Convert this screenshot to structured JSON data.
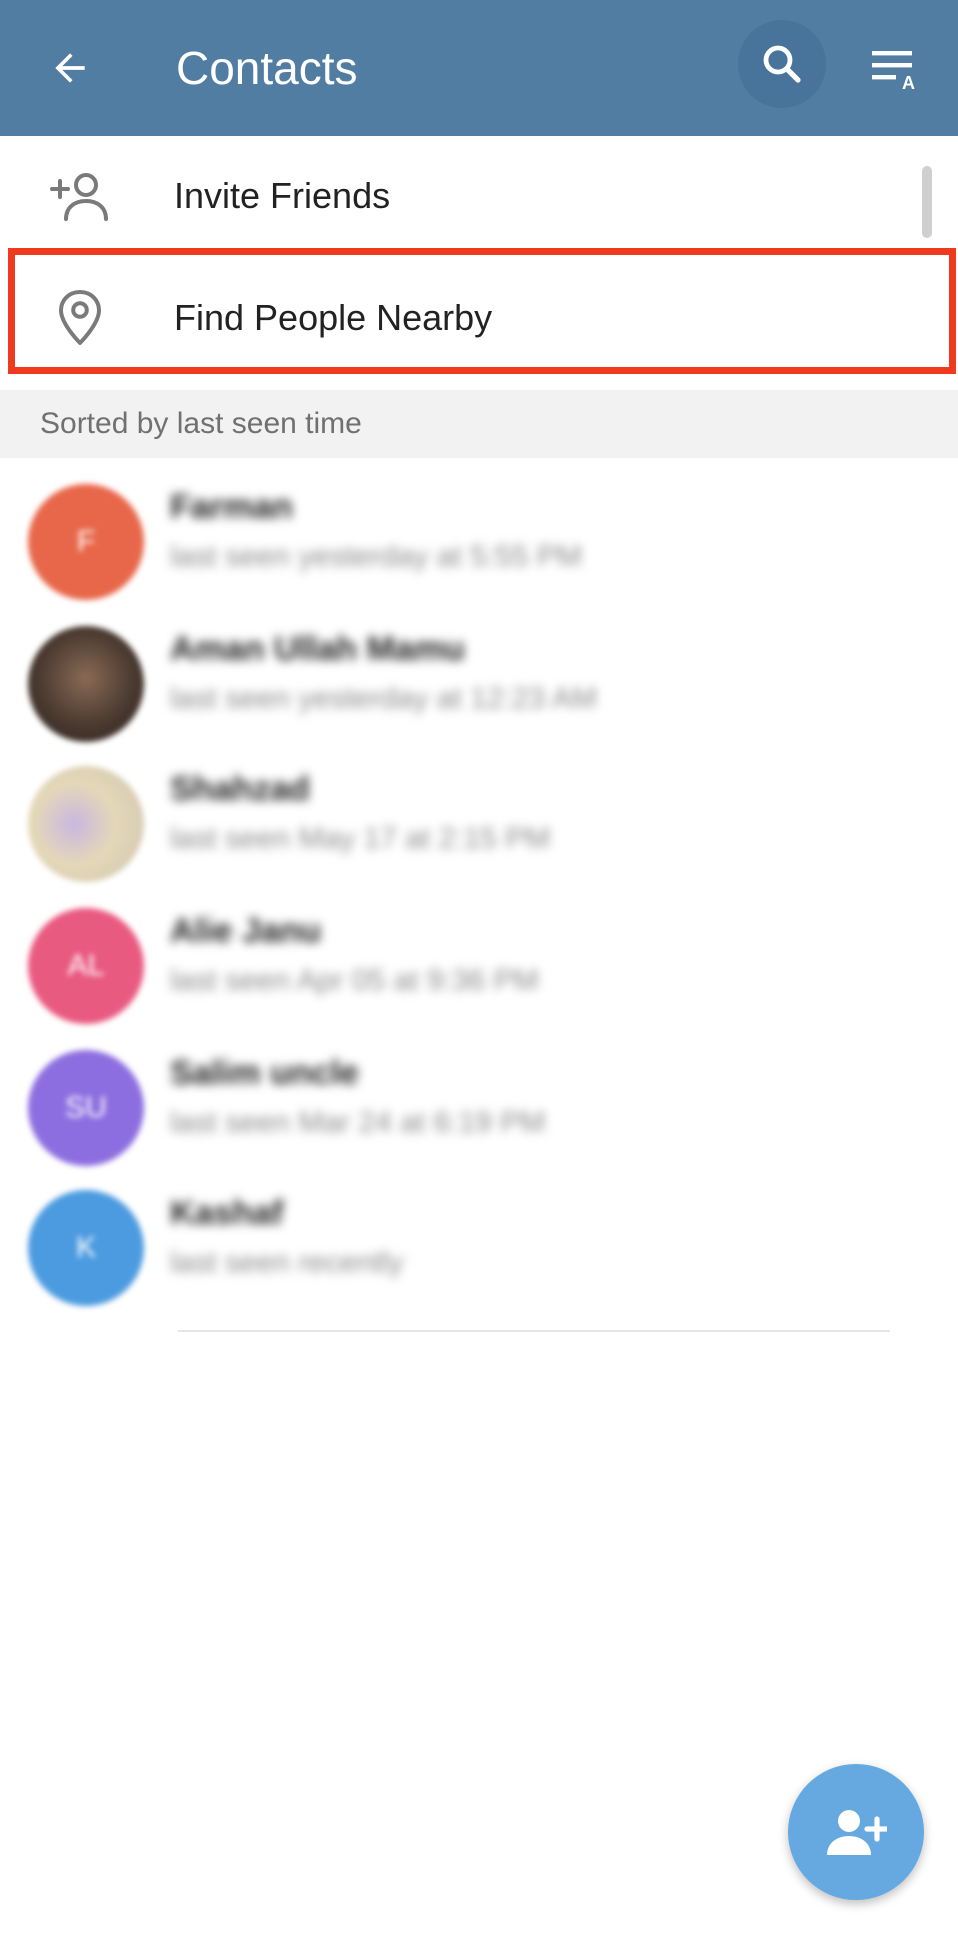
{
  "appbar": {
    "title": "Contacts",
    "color": "#527da3",
    "icons": [
      "back-arrow-icon",
      "search-icon",
      "sort-by-name-icon"
    ]
  },
  "menu": {
    "invite": {
      "label": "Invite Friends",
      "icon": "add-person-icon"
    },
    "nearby": {
      "label": "Find People Nearby",
      "icon": "location-pin-icon"
    }
  },
  "section": {
    "header": "Sorted by last seen time"
  },
  "contacts": [
    {
      "name": "Farman",
      "status": "last seen yesterday at 5:55 PM",
      "initials": "F",
      "color": "#e8674a"
    },
    {
      "name": "Aman Ullah Mamu",
      "status": "last seen yesterday at 12:23 AM",
      "initials": "",
      "color": "#4a3a30"
    },
    {
      "name": "Shahzad",
      "status": "last seen May 17 at 2:15 PM",
      "initials": "",
      "color": "#d8cfc0"
    },
    {
      "name": "Alie Janu",
      "status": "last seen Apr 05 at 9:36 PM",
      "initials": "AL",
      "color": "#e95a80"
    },
    {
      "name": "Salim uncle",
      "status": "last seen Mar 24 at 6:19 PM",
      "initials": "SU",
      "color": "#8d6ee0"
    },
    {
      "name": "Kashaf",
      "status": "last seen recently",
      "initials": "K",
      "color": "#4c9be0"
    }
  ],
  "fab": {
    "icon": "add-contact-icon",
    "color": "#65a9e0"
  },
  "highlight_color": "#ef3a1d"
}
